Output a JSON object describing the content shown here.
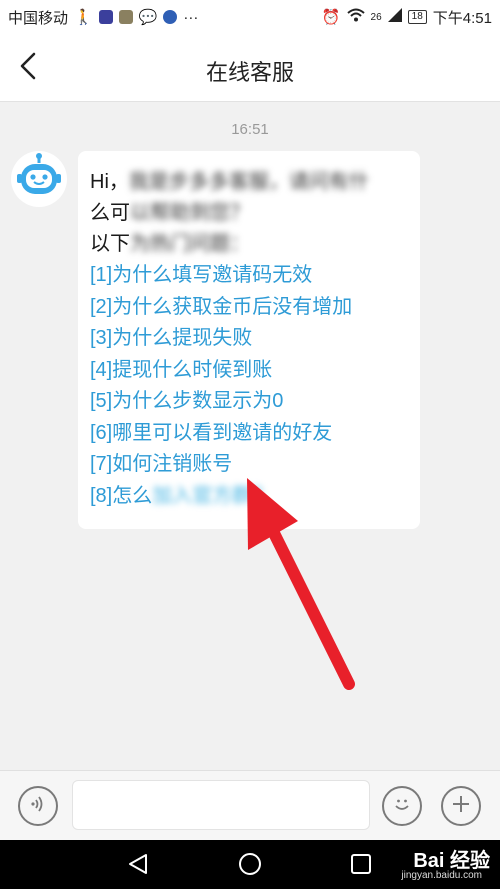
{
  "status_bar": {
    "carrier": "中国移动",
    "signal": "26",
    "battery": "18",
    "time": "下午4:51"
  },
  "header": {
    "title": "在线客服",
    "back_icon": "chevron-left-icon"
  },
  "chat": {
    "timestamp": "16:51",
    "greeting_prefix": "Hi，",
    "greeting_blurred": "我是步多多客服，请问有什",
    "line2_prefix": "么可",
    "line2_blurred": "以帮助到您？",
    "line3_prefix": "以下",
    "line3_blurred": "为热门问题：",
    "questions": [
      "[1]为什么填写邀请码无效",
      "[2]为什么获取金币后没有增加",
      "[3]为什么提现失败",
      "[4]提现什么时候到账",
      "[5]为什么步数显示为0",
      "[6]哪里可以看到邀请的好友",
      "[7]如何注销账号"
    ],
    "q8_prefix": "[8]怎么",
    "q8_blurred": "加入官方群？"
  },
  "input_bar": {
    "placeholder": "",
    "voice_icon": "voice-icon",
    "emoji_icon": "smile-icon",
    "plus_icon": "plus-icon"
  },
  "system_nav": {
    "back_icon": "triangle-back-icon",
    "home_icon": "circle-home-icon",
    "recent_icon": "square-recent-icon",
    "watermark": "Bai 经验",
    "watermark_sub": "jingyan.baidu.com"
  },
  "colors": {
    "link": "#2e9bd6",
    "arrow": "#e8202a",
    "background": "#f1f1f1"
  }
}
